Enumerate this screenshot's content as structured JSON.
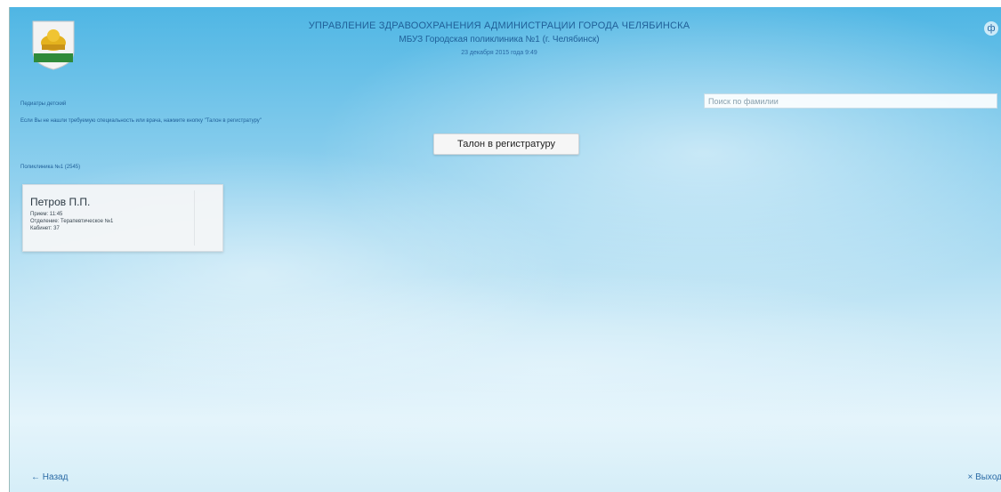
{
  "header": {
    "line1": "УПРАВЛЕНИЕ ЗДРАВООХРАНЕНИЯ АДМИНИСТРАЦИИ ГОРОДА ЧЕЛЯБИНСКА",
    "line2": "МБУЗ Городская поликлиника №1 (г. Челябинск)",
    "line3": "23 декабря 2015 года 9:49",
    "corner_icon": "ф"
  },
  "search": {
    "placeholder": "Поиск по фамилии"
  },
  "info": {
    "doctors_label": "Педиатры детский",
    "hint": "Если Вы не нашли требуемую специальность или врача, нажмите кнопку \"Талон в регистратуру\"",
    "polyclinic": "Поликлиника №1 (2545)"
  },
  "register_button": "Талон в регистратуру",
  "doctor_card": {
    "name": "Петров П.П.",
    "line1": "Прием: 11:45",
    "line2": "Отделение: Терапевтическое №1",
    "line3": "Кабинет: 37"
  },
  "footer": {
    "back": "← Назад",
    "exit": "× Выход"
  },
  "colors": {
    "sky_top": "#4fb6e4",
    "sky_bottom": "#e4f4fb",
    "header_text": "#1f5f98"
  }
}
